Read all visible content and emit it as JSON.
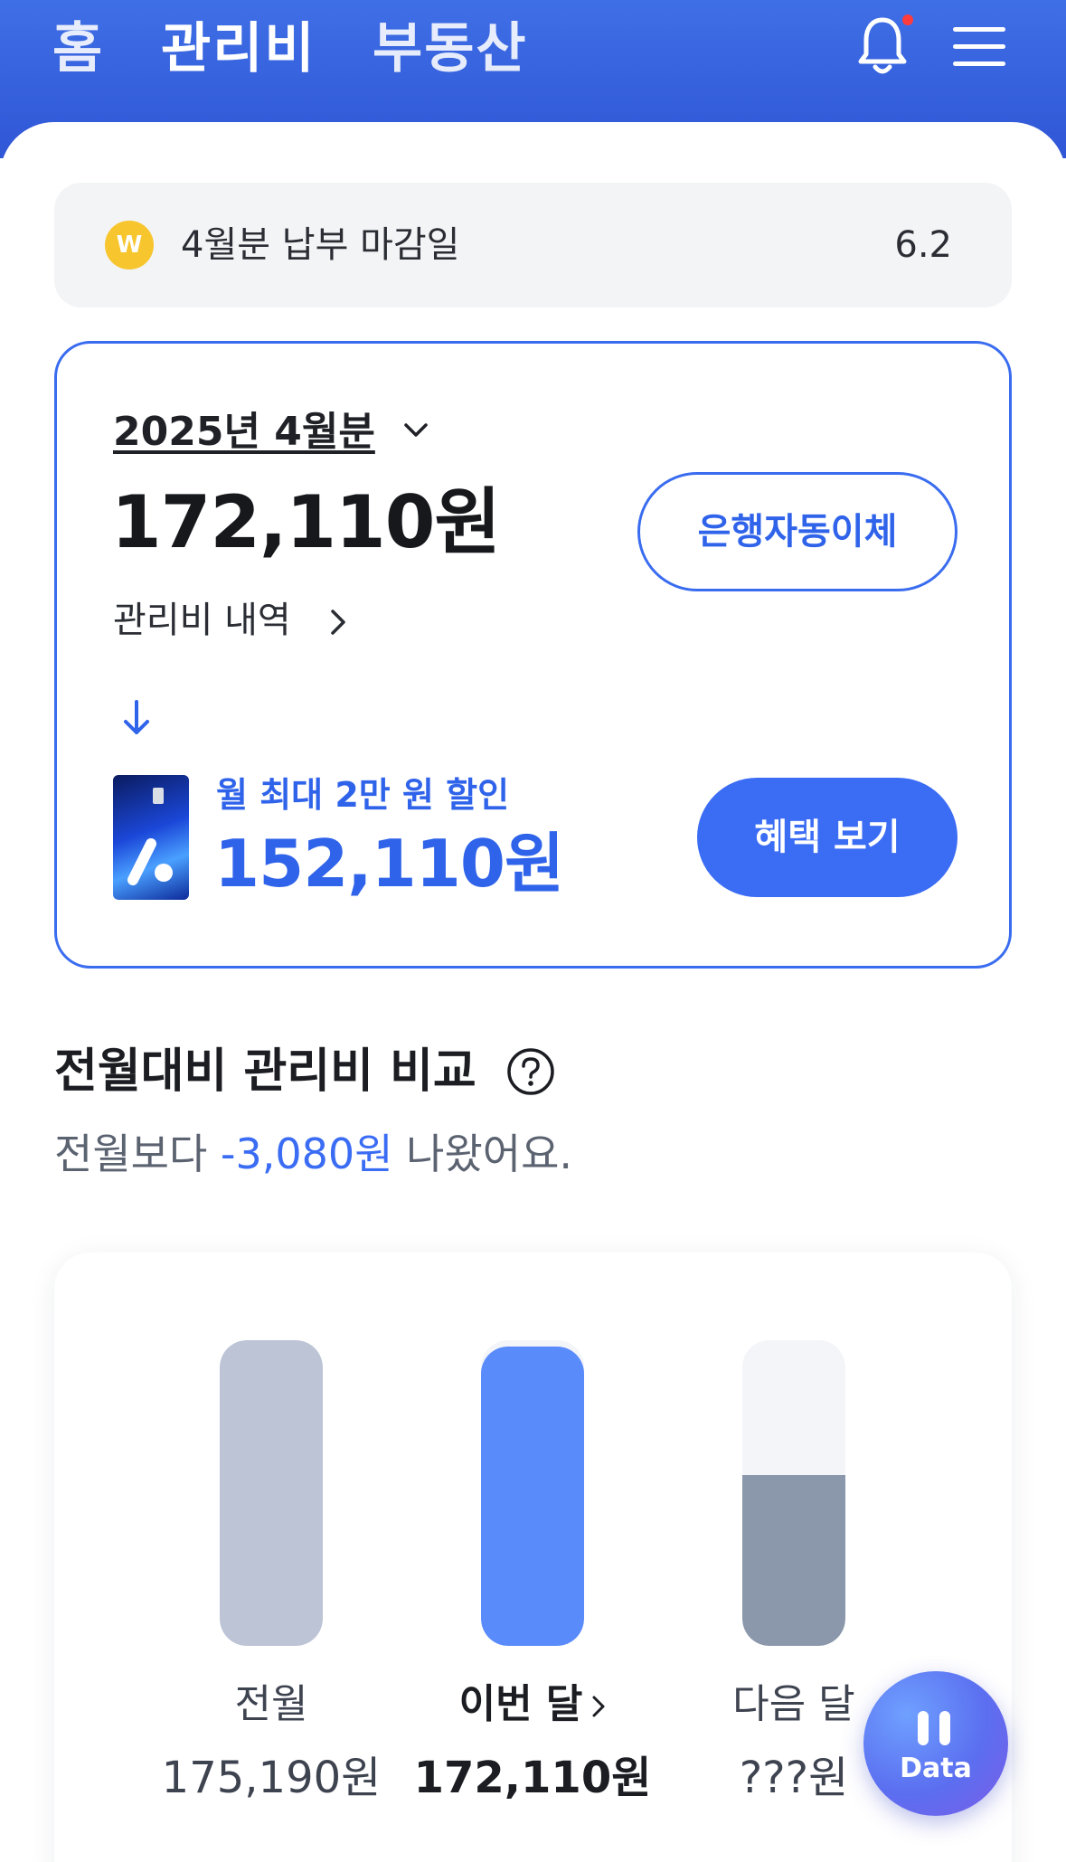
{
  "nav": {
    "tabs": [
      {
        "label": "홈"
      },
      {
        "label": "관리비"
      },
      {
        "label": "부동산"
      }
    ],
    "active_tab": "관리비"
  },
  "deadline": {
    "label": "4월분 납부 마감일",
    "date": "6.2",
    "icon": "won-coin-icon",
    "icon_glyph": "W"
  },
  "bill": {
    "period": "2025년 4월분",
    "amount": "172,110원",
    "detail_link": "관리비 내역",
    "autopay_button": "은행자동이체",
    "promo_label": "월 최대 2만 원 할인",
    "promo_amount": "152,110원",
    "benefit_button": "혜택 보기"
  },
  "comparison": {
    "title": "전월대비 관리비 비교",
    "subtitle_prefix": "전월보다 ",
    "subtitle_diff": "-3,080원",
    "subtitle_suffix": " 나왔어요.",
    "bars": [
      {
        "label": "전월",
        "value": "175,190원",
        "fill_fraction": 1.0,
        "color": "#bcc4d6"
      },
      {
        "label": "이번 달",
        "value": "172,110원",
        "fill_fraction": 0.98,
        "color": "#5a8bfb"
      },
      {
        "label": "다음 달",
        "value": "???원",
        "fill_fraction": 0.56,
        "color": "#8b98ab"
      }
    ]
  },
  "fab": {
    "label": "Data"
  },
  "colors": {
    "brand": "#3a6cf0",
    "header": "#3f6fe6",
    "deadline_bg": "#f3f4f6",
    "coin": "#f7c52d"
  }
}
